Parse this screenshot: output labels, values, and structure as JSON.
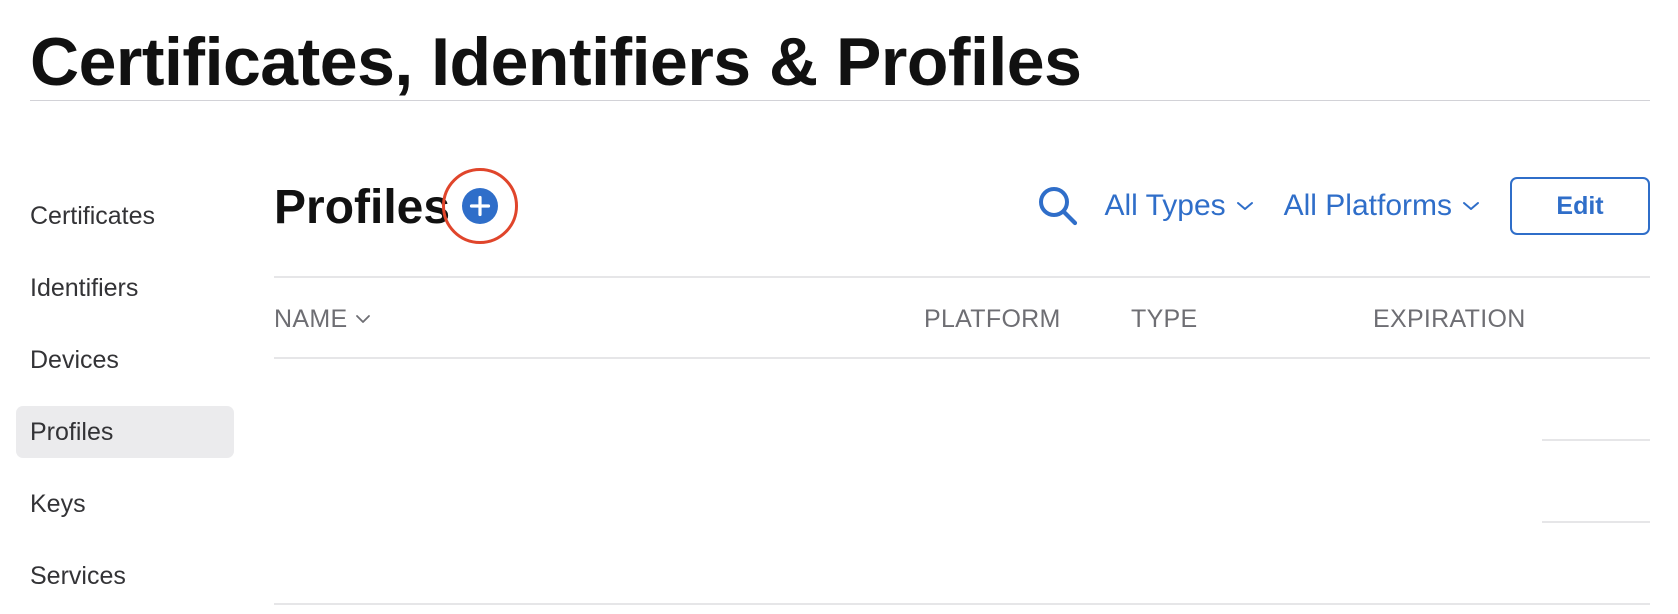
{
  "page": {
    "title": "Certificates, Identifiers & Profiles"
  },
  "sidebar": {
    "items": [
      {
        "label": "Certificates",
        "active": false
      },
      {
        "label": "Identifiers",
        "active": false
      },
      {
        "label": "Devices",
        "active": false
      },
      {
        "label": "Profiles",
        "active": true
      },
      {
        "label": "Keys",
        "active": false
      },
      {
        "label": "Services",
        "active": false
      }
    ]
  },
  "main": {
    "section_title": "Profiles",
    "add_icon": "plus-circle-icon",
    "search_icon": "search-icon",
    "filters": [
      {
        "label": "All Types",
        "icon": "chevron-down-icon"
      },
      {
        "label": "All Platforms",
        "icon": "chevron-down-icon"
      }
    ],
    "edit_label": "Edit"
  },
  "table": {
    "columns": [
      {
        "label": "NAME",
        "sortable": true
      },
      {
        "label": "PLATFORM"
      },
      {
        "label": "TYPE"
      },
      {
        "label": "EXPIRATION"
      }
    ],
    "rows": []
  },
  "colors": {
    "accent": "#2f6ec9",
    "highlight_ring": "#e0452b",
    "sidebar_active_bg": "#ebebed"
  }
}
